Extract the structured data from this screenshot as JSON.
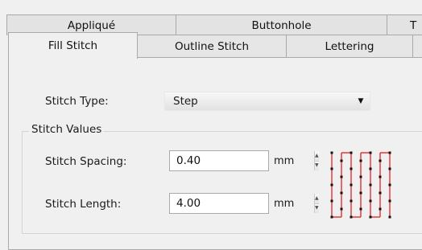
{
  "tabs_back": [
    {
      "label": "Appliqué"
    },
    {
      "label": "Buttonhole"
    },
    {
      "label": "T"
    }
  ],
  "tabs_front": [
    {
      "label": "Fill Stitch",
      "active": true
    },
    {
      "label": "Outline Stitch",
      "active": false
    },
    {
      "label": "Lettering",
      "active": false
    }
  ],
  "stitch_type": {
    "label": "Stitch Type:",
    "value": "Step",
    "arrow_icon": "dropdown-arrow-icon"
  },
  "stitch_values": {
    "title": "Stitch Values",
    "spacing": {
      "label": "Stitch Spacing:",
      "value": "0.40",
      "unit": "mm"
    },
    "length": {
      "label": "Stitch Length:",
      "value": "4.00",
      "unit": "mm"
    }
  },
  "colors": {
    "stitch_line": "#e02020",
    "stitch_point": "#111111"
  }
}
